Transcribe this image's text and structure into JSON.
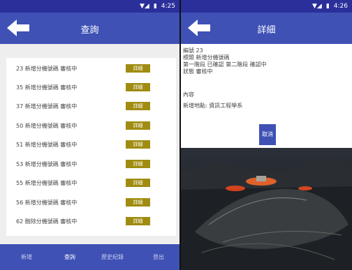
{
  "left": {
    "status": {
      "time": "4:25"
    },
    "appbar": {
      "title": "查詢"
    },
    "list": [
      {
        "text": "23  新增分機號碼  審核中",
        "button": "詳細"
      },
      {
        "text": "35  新增分機號碼  審核中",
        "button": "詳細"
      },
      {
        "text": "37  新增分機號碼  審核中",
        "button": "詳細"
      },
      {
        "text": "50  新增分機號碼  審核中",
        "button": "詳細"
      },
      {
        "text": "51  新增分機號碼  審核中",
        "button": "詳細"
      },
      {
        "text": "53  新增分機號碼  審核中",
        "button": "詳細"
      },
      {
        "text": "55  新增分機號碼  審核中",
        "button": "詳細"
      },
      {
        "text": "56  新增分機號碼  審核中",
        "button": "詳細"
      },
      {
        "text": "62  刪除分機號碼  審核中",
        "button": "詳細"
      }
    ],
    "nav": {
      "add": "新增",
      "query": "查詢",
      "history": "歷史紀錄",
      "logout": "登出"
    }
  },
  "right": {
    "status": {
      "time": "4:26"
    },
    "appbar": {
      "title": "詳細"
    },
    "detail": {
      "line1": "編號  23",
      "line2": "標題  新增分機號碼",
      "line3": "第一階段 已確認    第二階段 確認中",
      "line4": "狀態  審核中",
      "content_label": "內容",
      "content_value": "新增地點: 資訊工程學系"
    },
    "cancel_label": "取消"
  },
  "colors": {
    "primary": "#3f51b5",
    "statusbar": "#2a2f9a",
    "detail_button": "#a08c10"
  }
}
